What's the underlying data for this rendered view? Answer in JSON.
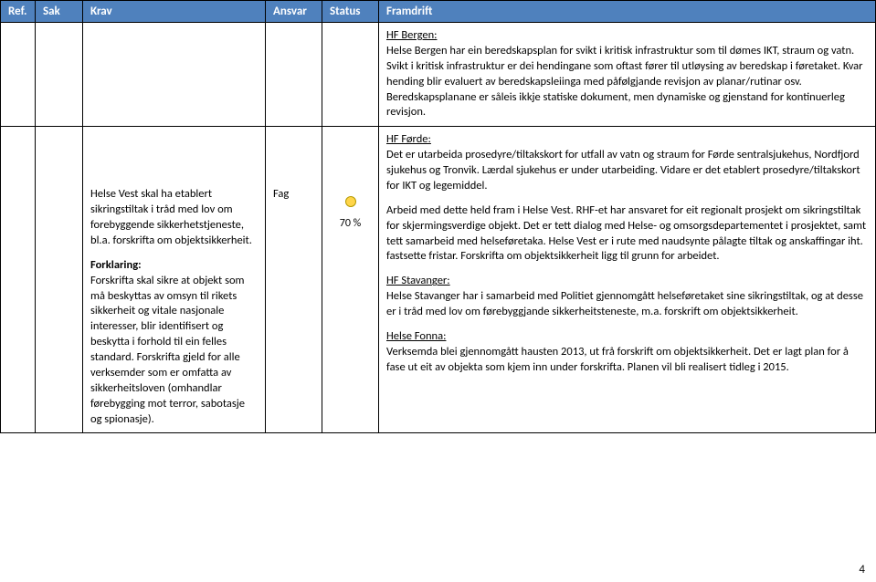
{
  "headers": {
    "ref": "Ref.",
    "sak": "Sak",
    "krav": "Krav",
    "ansvar": "Ansvar",
    "status": "Status",
    "framdrift": "Framdrift"
  },
  "row1": {
    "framdrift": {
      "title": "HF Bergen:",
      "text": "Helse Bergen har ein beredskapsplan for svikt i kritisk infrastruktur som til dømes IKT, straum og vatn. Svikt i kritisk infrastruktur er dei hendingane som oftast fører til utløysing av beredskap i føretaket. Kvar hending blir evaluert av beredskapsleiinga med påfølgjande revisjon av planar/rutinar osv. Beredskapsplanane er såleis ikkje statiske dokument, men dynamiske og gjenstand for kontinuerleg revisjon."
    }
  },
  "row2": {
    "krav": {
      "p1": "Helse Vest skal ha etablert sikringstiltak i tråd med lov om forebyggende sikkerhetstjeneste, bl.a. forskrifta om objektsikkerheit.",
      "forklaring_label": "Forklaring:",
      "p2": "Forskrifta skal sikre at objekt som må beskyttas av omsyn til rikets sikkerheit og vitale nasjonale interesser, blir identifisert og beskytta i forhold til ein felles standard. Forskrifta gjeld for alle verksemder som er omfatta av sikkerheitsloven (omhandlar førebygging mot terror, sabotasje og spionasje)."
    },
    "ansvar": "Fag",
    "status_pct": "70 %",
    "framdrift": {
      "forde_title": "HF Førde:",
      "forde_text": "Det er utarbeida prosedyre/tiltakskort for utfall av vatn og straum for Førde sentralsjukehus, Nordfjord sjukehus og Tronvik. Lærdal sjukehus er under utarbeiding. Vidare er det etablert prosedyre/tiltakskort for IKT og legemiddel.",
      "arbeid_text": "Arbeid med dette held fram i Helse Vest. RHF-et har ansvaret for eit regionalt prosjekt om sikringstiltak for skjermingsverdige objekt. Det er tett dialog med Helse- og omsorgsdepartementet i prosjektet, samt tett samarbeid med helseføretaka. Helse Vest er i rute med naudsynte pålagte tiltak og anskaffingar iht. fastsette fristar. Forskrifta om objektsikkerheit ligg til grunn for arbeidet.",
      "stavanger_title": "HF Stavanger:",
      "stavanger_text": "Helse Stavanger har i samarbeid med Politiet gjennomgått helseføretaket sine sikringstiltak, og at desse er i tråd med lov om førebyggjande sikkerheitsteneste, m.a. forskrift om objektsikkerheit.",
      "fonna_title": "Helse Fonna:",
      "fonna_text": "Verksemda blei gjennomgått hausten 2013, ut frå forskrift om objektsikkerheit. Det er lagt plan for å fase ut eit av objekta som kjem inn under forskrifta. Planen vil bli realisert tidleg i 2015."
    }
  },
  "page_number": "4"
}
